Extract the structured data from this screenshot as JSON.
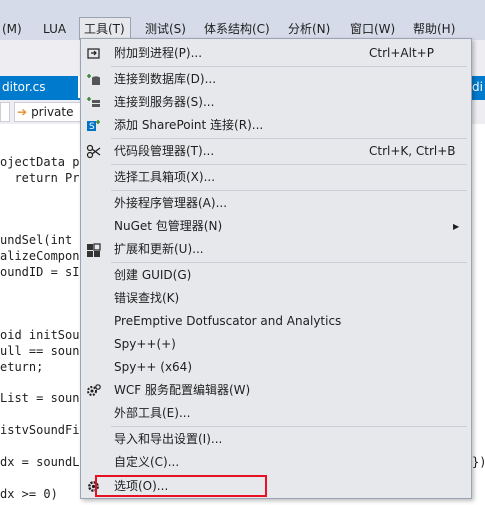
{
  "menubar": {
    "items": [
      {
        "label": "(M)"
      },
      {
        "label": "LUA"
      },
      {
        "label": "工具(T)"
      },
      {
        "label": "测试(S)"
      },
      {
        "label": "体系结构(C)"
      },
      {
        "label": "分析(N)"
      },
      {
        "label": "窗口(W)"
      },
      {
        "label": "帮助(H)"
      }
    ]
  },
  "tabs": {
    "active": "ditor.cs",
    "right": "di"
  },
  "navbar": {
    "member": "private"
  },
  "code": [
    "ojectData p",
    "  return Pro",
    "",
    "",
    "undSel(int",
    "alizeCompon",
    "oundID = sI",
    "",
    "",
    "oid initSou",
    "ull == soun",
    "eturn;",
    "",
    "List = soun",
    "",
    "istvSoundFi",
    "",
    "dx = soundL",
    "",
    "dx >= 0)"
  ],
  "code_right": "})",
  "menu": {
    "items": [
      {
        "label": "附加到进程(P)...",
        "shortcut": "Ctrl+Alt+P",
        "icon": "attach-process-icon"
      },
      {
        "label": "连接到数据库(D)...",
        "icon": "connect-database-icon"
      },
      {
        "label": "连接到服务器(S)...",
        "icon": "connect-server-icon"
      },
      {
        "label": "添加 SharePoint 连接(R)...",
        "icon": "sharepoint-icon"
      },
      {
        "label": "代码段管理器(T)...",
        "shortcut": "Ctrl+K, Ctrl+B",
        "icon": "snippet-manager-icon"
      },
      {
        "label": "选择工具箱项(X)..."
      },
      {
        "label": "外接程序管理器(A)..."
      },
      {
        "label": "NuGet 包管理器(N)",
        "submenu": true
      },
      {
        "label": "扩展和更新(U)...",
        "icon": "extensions-icon"
      },
      {
        "label": "创建 GUID(G)"
      },
      {
        "label": "错误查找(K)"
      },
      {
        "label": "PreEmptive Dotfuscator and Analytics"
      },
      {
        "label": "Spy++(+)"
      },
      {
        "label": "Spy++ (x64)"
      },
      {
        "label": "WCF 服务配置编辑器(W)",
        "icon": "wcf-config-icon"
      },
      {
        "label": "外部工具(E)..."
      },
      {
        "label": "导入和导出设置(I)..."
      },
      {
        "label": "自定义(C)..."
      },
      {
        "label": "选项(O)...",
        "icon": "gear-icon"
      }
    ]
  }
}
